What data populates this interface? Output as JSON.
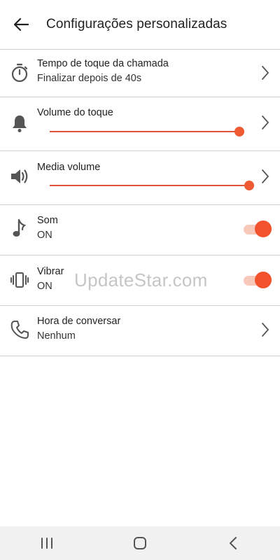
{
  "header": {
    "title": "Configurações personalizadas"
  },
  "rows": {
    "ring_time": {
      "label": "Tempo de toque da chamada",
      "value": "Finalizar depois de 40s"
    },
    "ring_volume": {
      "label": "Volume do toque",
      "level": 0.95
    },
    "media_volume": {
      "label": "Media volume",
      "level": 1.0
    },
    "sound": {
      "label": "Som",
      "value": "ON",
      "enabled": true
    },
    "vibrate": {
      "label": "Vibrar",
      "value": "ON",
      "enabled": true
    },
    "talk_time": {
      "label": "Hora de conversar",
      "value": "Nenhum"
    }
  },
  "watermark": "UpdateStar.com",
  "colors": {
    "accent": "#f2532e",
    "accent_light": "#f8c8bb",
    "divider": "#cfcfcf",
    "navbar": "#f1f1f1"
  },
  "icons": [
    "back-arrow-icon",
    "timer-icon",
    "bell-icon",
    "speaker-icon",
    "music-note-icon",
    "vibrate-icon",
    "phone-icon",
    "chevron-right-icon",
    "recents-icon",
    "home-icon",
    "nav-back-icon"
  ]
}
